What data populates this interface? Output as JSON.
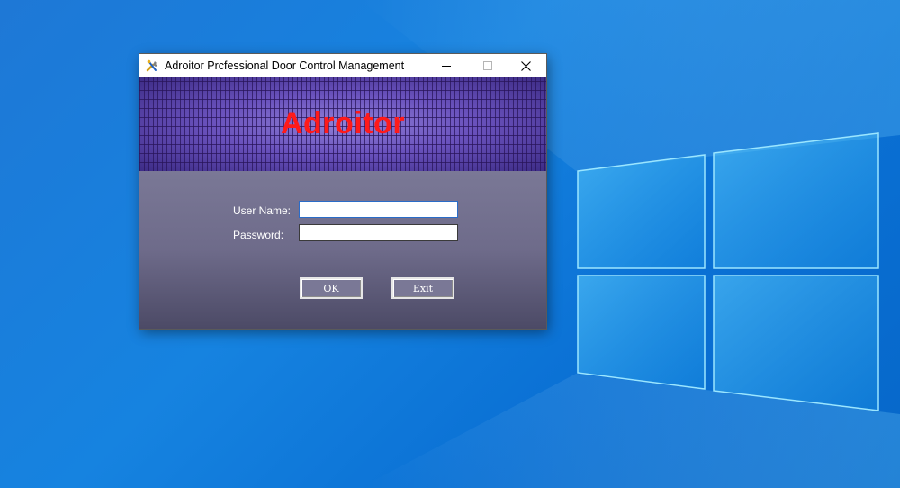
{
  "window": {
    "title": "Adroitor Prcfessional Door Control Management",
    "icon": "tools-icon",
    "controls": {
      "minimize_icon": "minimize-icon",
      "maximize_icon": "maximize-icon",
      "close_icon": "close-icon"
    }
  },
  "banner": {
    "title": "Adroitor",
    "title_color": "#ff1a1a"
  },
  "login": {
    "username_label": "User Name:",
    "username_value": "",
    "password_label": "Password:",
    "password_value": "",
    "ok_label": "OK",
    "exit_label": "Exit"
  },
  "desktop": {
    "background_color": "#1683e0",
    "logo": "windows-logo"
  }
}
